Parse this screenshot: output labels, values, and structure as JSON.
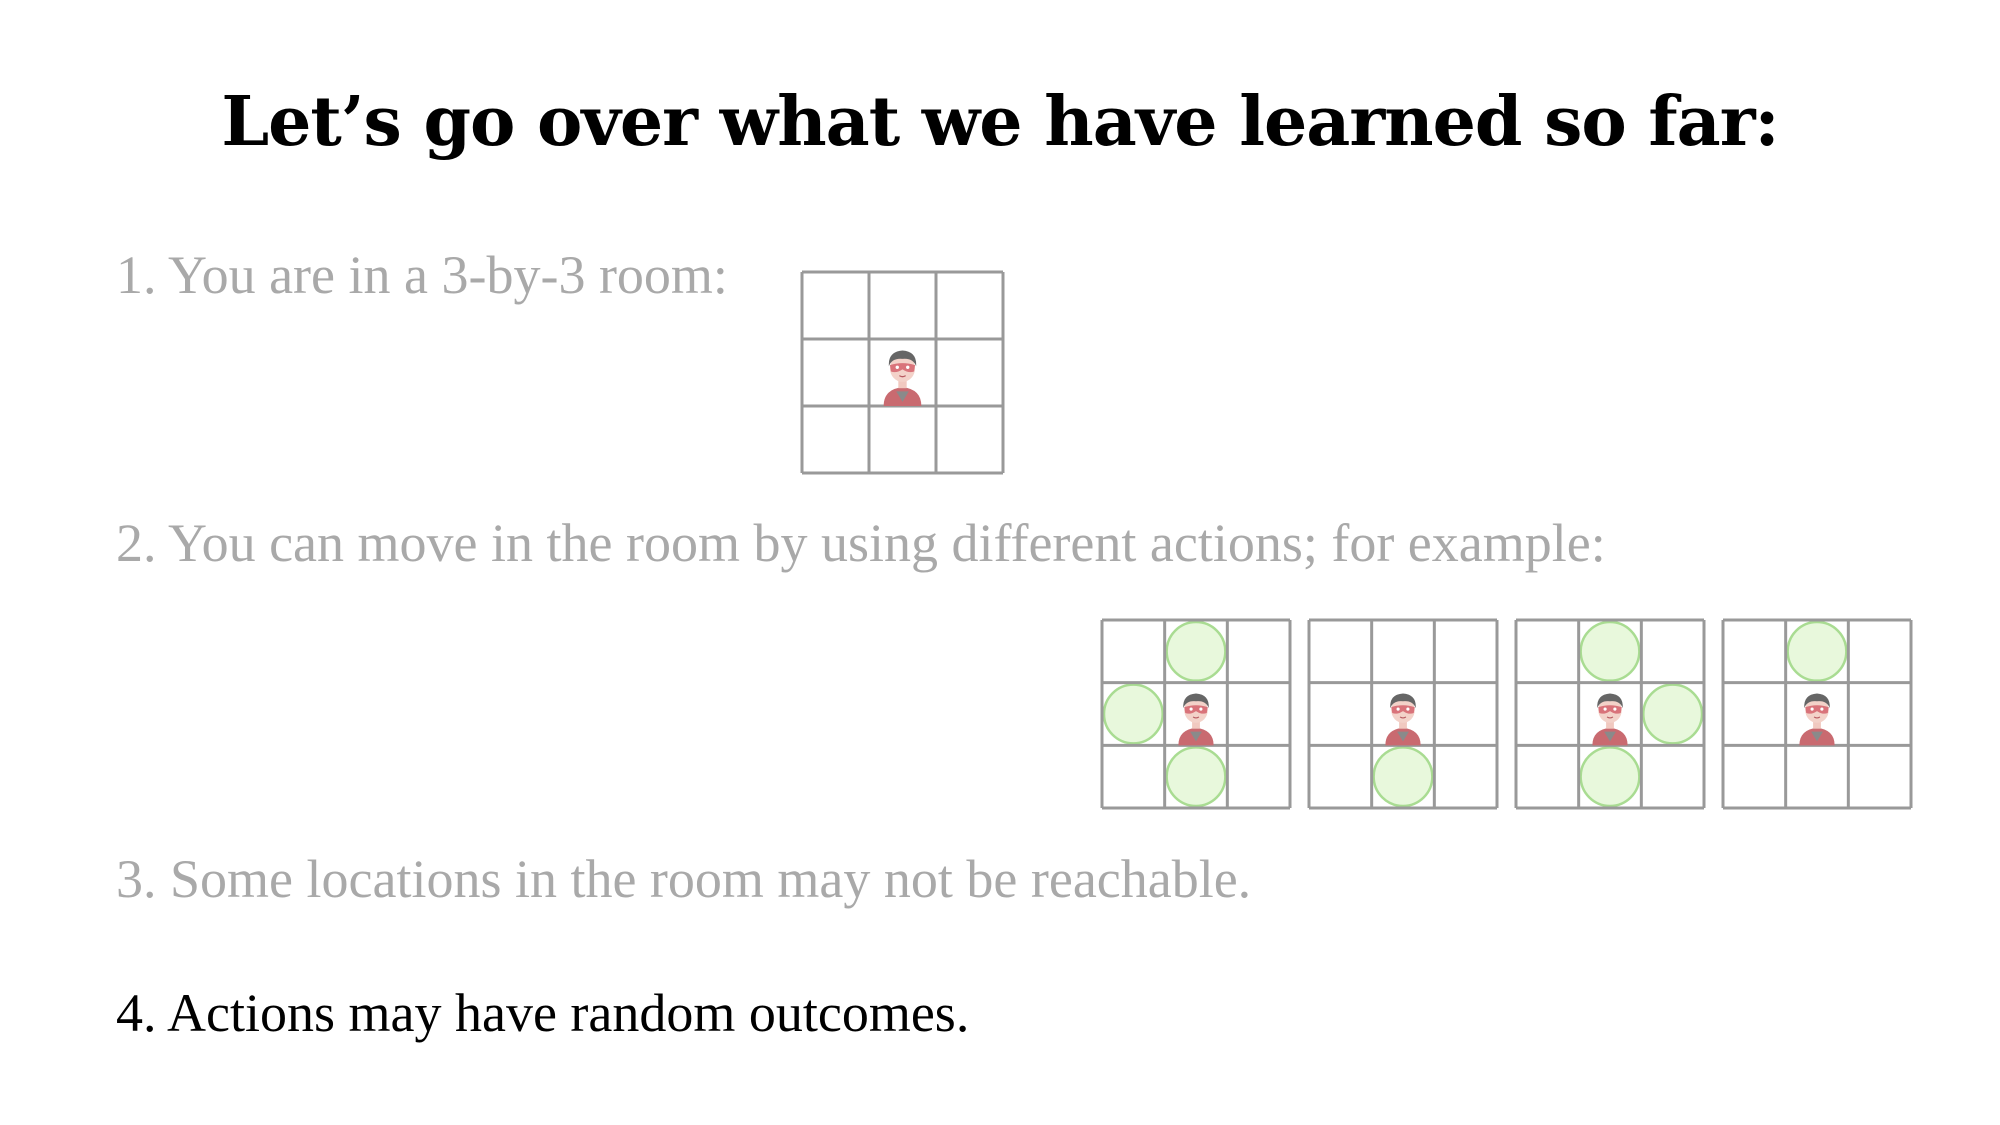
{
  "slide": {
    "title": "Let’s go over what we have learned so far:",
    "items": [
      {
        "text": "1. You are in a 3-by-3 room:",
        "state": "faded"
      },
      {
        "text": "2. You can move in the room by using different actions; for example:",
        "state": "faded"
      },
      {
        "text": "3. Some locations in the room may not be reachable.",
        "state": "faded"
      },
      {
        "text": "4. Actions may have random outcomes.",
        "state": "active"
      }
    ]
  },
  "colors": {
    "faded_text": "#a9a9a9",
    "active_text": "#000000",
    "grid_line": "#999999",
    "reachable_fill": "#e8f8dc",
    "reachable_stroke": "#a9dc92",
    "avatar_hair": "#666666",
    "avatar_mask": "#d9737a"
  },
  "icons": {
    "avatar": "superhero-avatar-icon",
    "reachable": "reachable-circle-icon"
  },
  "room": {
    "size": 3,
    "agent": [
      1,
      1
    ],
    "action_examples": [
      {
        "reachable": [
          [
            0,
            1
          ],
          [
            1,
            0
          ],
          [
            2,
            1
          ]
        ]
      },
      {
        "reachable": [
          [
            2,
            1
          ]
        ]
      },
      {
        "reachable": [
          [
            0,
            1
          ],
          [
            1,
            2
          ],
          [
            2,
            1
          ]
        ]
      },
      {
        "reachable": [
          [
            0,
            1
          ]
        ]
      }
    ]
  }
}
